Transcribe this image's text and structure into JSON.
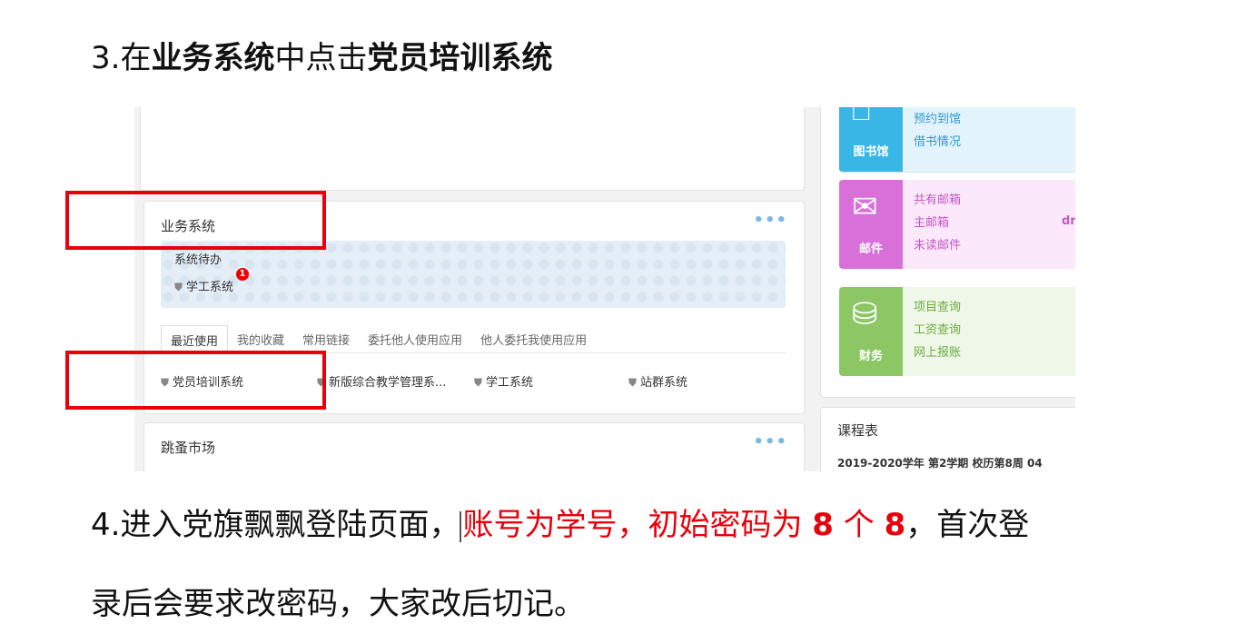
{
  "step3": {
    "num": "3.",
    "t1": "在",
    "t2": "业务系统",
    "t3": "中点击",
    "t4": "党员培训系统"
  },
  "screenshot": {
    "business_card": {
      "title": "业务系统",
      "dots": "•••",
      "todo_title": "系统待办",
      "todo_item": "学工系统",
      "todo_badge": "1",
      "tabs": [
        "最近使用",
        "我的收藏",
        "常用链接",
        "委托他人使用应用",
        "他人委托我使用应用"
      ],
      "apps": [
        "党员培训系统",
        "新版综合教学管理系...",
        "学工系统",
        "站群系统"
      ]
    },
    "market_card": {
      "title": "跳蚤市场",
      "dots": "•••"
    },
    "library": {
      "name": "图书馆",
      "links": [
        "预约到馆",
        "借书情况"
      ]
    },
    "mail": {
      "name": "邮件",
      "links": [
        "共有邮箱",
        "主邮箱",
        "未读邮件"
      ],
      "extra": "dr"
    },
    "finance": {
      "name": "财务",
      "links": [
        "项目查询",
        "工资查询",
        "网上报账"
      ]
    },
    "course": {
      "title": "课程表",
      "info": "2019-2020学年 第2学期 校历第8周   04"
    }
  },
  "step4": {
    "t1": "4.进入党旗飘飘登陆页面，",
    "t2": "账号为学号，初始密码为 ",
    "t3": "8",
    "t4": " 个 ",
    "t5": "8",
    "t6": "，首次登",
    "t7": "录后会要求改密码，大家改后切记。"
  },
  "colors": {
    "highlight": "#e8000b",
    "library": "#3ab6e6",
    "mail": "#d96fd8",
    "finance": "#8cc665"
  },
  "icons": [
    "library-icon",
    "mail-icon",
    "finance-icon",
    "app-icon",
    "dots-icon"
  ]
}
